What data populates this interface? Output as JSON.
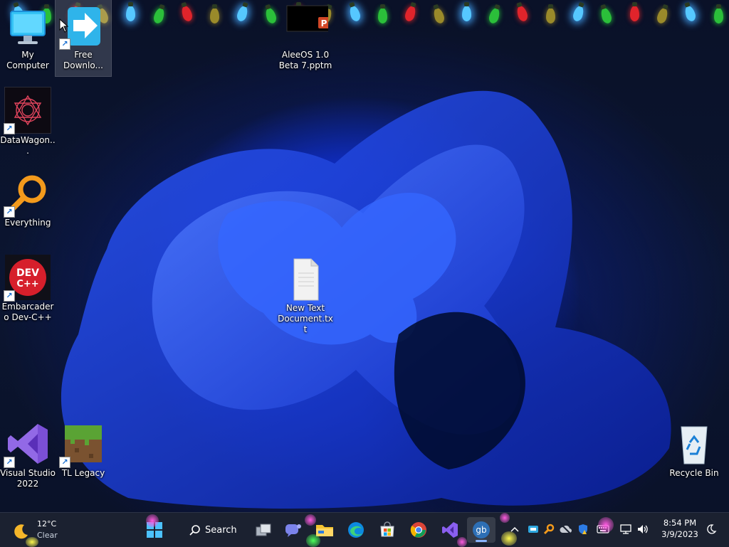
{
  "desktop": {
    "icons": [
      {
        "label": "My Computer"
      },
      {
        "label": "Free Downlo..."
      },
      {
        "label": "AleeOS 1.0 Beta 7.pptm"
      },
      {
        "label": "DataWagon..."
      },
      {
        "label": "Everything"
      },
      {
        "label": "Embarcadero Dev-C++"
      },
      {
        "label": "New Text Document.txt"
      },
      {
        "label": "Visual Studio 2022"
      },
      {
        "label": "TL Legacy"
      },
      {
        "label": "Recycle Bin"
      }
    ],
    "decoration": "holiday-lights"
  },
  "taskbar": {
    "weather": {
      "temp": "12°C",
      "condition": "Clear",
      "icon": "moon-icon"
    },
    "search_label": "Search",
    "pinned": [
      {
        "name": "start-button",
        "icon": "windows-icon"
      },
      {
        "name": "search-button",
        "icon": "search-icon"
      },
      {
        "name": "task-view-button",
        "icon": "task-view-icon"
      },
      {
        "name": "teams-chat-button",
        "icon": "chat-icon"
      },
      {
        "name": "file-explorer-button",
        "icon": "folder-icon"
      },
      {
        "name": "edge-button",
        "icon": "edge-icon"
      },
      {
        "name": "store-button",
        "icon": "store-icon"
      },
      {
        "name": "chrome-button",
        "icon": "chrome-icon"
      },
      {
        "name": "visual-studio-button",
        "icon": "visual-studio-icon"
      },
      {
        "name": "gb-app-button",
        "icon": "gb-icon",
        "label": "gb",
        "active": true
      }
    ],
    "tray": [
      "chevron-up-icon",
      "app-tray-icon",
      "everything-tray-icon",
      "cloud-offline-icon",
      "security-icon",
      "keyboard-icon",
      "network-icon",
      "volume-icon"
    ],
    "clock": {
      "time": "8:54 PM",
      "date": "3/9/2023"
    },
    "focus_icon": "moon-focus-icon"
  },
  "colors": {
    "accent": "#1b44f0",
    "taskbar_bg": "#1b2130",
    "active_indicator": "#8ab4ff"
  }
}
